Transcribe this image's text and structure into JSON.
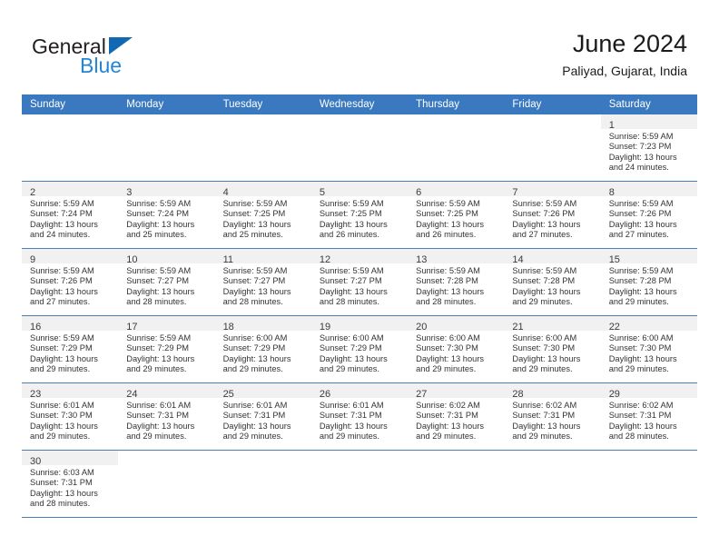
{
  "brand": {
    "name_top": "General",
    "name_bottom": "Blue",
    "triangle_icon": "triangle-icon",
    "color_dark": "#231f20",
    "color_blue": "#2585d3"
  },
  "header": {
    "title": "June 2024",
    "subtitle": "Paliyad, Gujarat, India"
  },
  "theme": {
    "header_row_bg": "#3a79bf",
    "header_row_text": "#ffffff",
    "daynum_band_bg": "#f1f1f1",
    "row_divider": "#4a7fbd"
  },
  "weekdays": [
    "Sunday",
    "Monday",
    "Tuesday",
    "Wednesday",
    "Thursday",
    "Friday",
    "Saturday"
  ],
  "calendar": {
    "month": "June",
    "year": "2024",
    "weeks": [
      [
        {
          "empty": true
        },
        {
          "empty": true
        },
        {
          "empty": true
        },
        {
          "empty": true
        },
        {
          "empty": true
        },
        {
          "empty": true
        },
        {
          "day": "1",
          "sunrise": "Sunrise: 5:59 AM",
          "sunset": "Sunset: 7:23 PM",
          "daylight1": "Daylight: 13 hours",
          "daylight2": "and 24 minutes."
        }
      ],
      [
        {
          "day": "2",
          "sunrise": "Sunrise: 5:59 AM",
          "sunset": "Sunset: 7:24 PM",
          "daylight1": "Daylight: 13 hours",
          "daylight2": "and 24 minutes."
        },
        {
          "day": "3",
          "sunrise": "Sunrise: 5:59 AM",
          "sunset": "Sunset: 7:24 PM",
          "daylight1": "Daylight: 13 hours",
          "daylight2": "and 25 minutes."
        },
        {
          "day": "4",
          "sunrise": "Sunrise: 5:59 AM",
          "sunset": "Sunset: 7:25 PM",
          "daylight1": "Daylight: 13 hours",
          "daylight2": "and 25 minutes."
        },
        {
          "day": "5",
          "sunrise": "Sunrise: 5:59 AM",
          "sunset": "Sunset: 7:25 PM",
          "daylight1": "Daylight: 13 hours",
          "daylight2": "and 26 minutes."
        },
        {
          "day": "6",
          "sunrise": "Sunrise: 5:59 AM",
          "sunset": "Sunset: 7:25 PM",
          "daylight1": "Daylight: 13 hours",
          "daylight2": "and 26 minutes."
        },
        {
          "day": "7",
          "sunrise": "Sunrise: 5:59 AM",
          "sunset": "Sunset: 7:26 PM",
          "daylight1": "Daylight: 13 hours",
          "daylight2": "and 27 minutes."
        },
        {
          "day": "8",
          "sunrise": "Sunrise: 5:59 AM",
          "sunset": "Sunset: 7:26 PM",
          "daylight1": "Daylight: 13 hours",
          "daylight2": "and 27 minutes."
        }
      ],
      [
        {
          "day": "9",
          "sunrise": "Sunrise: 5:59 AM",
          "sunset": "Sunset: 7:26 PM",
          "daylight1": "Daylight: 13 hours",
          "daylight2": "and 27 minutes."
        },
        {
          "day": "10",
          "sunrise": "Sunrise: 5:59 AM",
          "sunset": "Sunset: 7:27 PM",
          "daylight1": "Daylight: 13 hours",
          "daylight2": "and 28 minutes."
        },
        {
          "day": "11",
          "sunrise": "Sunrise: 5:59 AM",
          "sunset": "Sunset: 7:27 PM",
          "daylight1": "Daylight: 13 hours",
          "daylight2": "and 28 minutes."
        },
        {
          "day": "12",
          "sunrise": "Sunrise: 5:59 AM",
          "sunset": "Sunset: 7:27 PM",
          "daylight1": "Daylight: 13 hours",
          "daylight2": "and 28 minutes."
        },
        {
          "day": "13",
          "sunrise": "Sunrise: 5:59 AM",
          "sunset": "Sunset: 7:28 PM",
          "daylight1": "Daylight: 13 hours",
          "daylight2": "and 28 minutes."
        },
        {
          "day": "14",
          "sunrise": "Sunrise: 5:59 AM",
          "sunset": "Sunset: 7:28 PM",
          "daylight1": "Daylight: 13 hours",
          "daylight2": "and 29 minutes."
        },
        {
          "day": "15",
          "sunrise": "Sunrise: 5:59 AM",
          "sunset": "Sunset: 7:28 PM",
          "daylight1": "Daylight: 13 hours",
          "daylight2": "and 29 minutes."
        }
      ],
      [
        {
          "day": "16",
          "sunrise": "Sunrise: 5:59 AM",
          "sunset": "Sunset: 7:29 PM",
          "daylight1": "Daylight: 13 hours",
          "daylight2": "and 29 minutes."
        },
        {
          "day": "17",
          "sunrise": "Sunrise: 5:59 AM",
          "sunset": "Sunset: 7:29 PM",
          "daylight1": "Daylight: 13 hours",
          "daylight2": "and 29 minutes."
        },
        {
          "day": "18",
          "sunrise": "Sunrise: 6:00 AM",
          "sunset": "Sunset: 7:29 PM",
          "daylight1": "Daylight: 13 hours",
          "daylight2": "and 29 minutes."
        },
        {
          "day": "19",
          "sunrise": "Sunrise: 6:00 AM",
          "sunset": "Sunset: 7:29 PM",
          "daylight1": "Daylight: 13 hours",
          "daylight2": "and 29 minutes."
        },
        {
          "day": "20",
          "sunrise": "Sunrise: 6:00 AM",
          "sunset": "Sunset: 7:30 PM",
          "daylight1": "Daylight: 13 hours",
          "daylight2": "and 29 minutes."
        },
        {
          "day": "21",
          "sunrise": "Sunrise: 6:00 AM",
          "sunset": "Sunset: 7:30 PM",
          "daylight1": "Daylight: 13 hours",
          "daylight2": "and 29 minutes."
        },
        {
          "day": "22",
          "sunrise": "Sunrise: 6:00 AM",
          "sunset": "Sunset: 7:30 PM",
          "daylight1": "Daylight: 13 hours",
          "daylight2": "and 29 minutes."
        }
      ],
      [
        {
          "day": "23",
          "sunrise": "Sunrise: 6:01 AM",
          "sunset": "Sunset: 7:30 PM",
          "daylight1": "Daylight: 13 hours",
          "daylight2": "and 29 minutes."
        },
        {
          "day": "24",
          "sunrise": "Sunrise: 6:01 AM",
          "sunset": "Sunset: 7:31 PM",
          "daylight1": "Daylight: 13 hours",
          "daylight2": "and 29 minutes."
        },
        {
          "day": "25",
          "sunrise": "Sunrise: 6:01 AM",
          "sunset": "Sunset: 7:31 PM",
          "daylight1": "Daylight: 13 hours",
          "daylight2": "and 29 minutes."
        },
        {
          "day": "26",
          "sunrise": "Sunrise: 6:01 AM",
          "sunset": "Sunset: 7:31 PM",
          "daylight1": "Daylight: 13 hours",
          "daylight2": "and 29 minutes."
        },
        {
          "day": "27",
          "sunrise": "Sunrise: 6:02 AM",
          "sunset": "Sunset: 7:31 PM",
          "daylight1": "Daylight: 13 hours",
          "daylight2": "and 29 minutes."
        },
        {
          "day": "28",
          "sunrise": "Sunrise: 6:02 AM",
          "sunset": "Sunset: 7:31 PM",
          "daylight1": "Daylight: 13 hours",
          "daylight2": "and 29 minutes."
        },
        {
          "day": "29",
          "sunrise": "Sunrise: 6:02 AM",
          "sunset": "Sunset: 7:31 PM",
          "daylight1": "Daylight: 13 hours",
          "daylight2": "and 28 minutes."
        }
      ],
      [
        {
          "day": "30",
          "sunrise": "Sunrise: 6:03 AM",
          "sunset": "Sunset: 7:31 PM",
          "daylight1": "Daylight: 13 hours",
          "daylight2": "and 28 minutes."
        },
        {
          "empty": true
        },
        {
          "empty": true
        },
        {
          "empty": true
        },
        {
          "empty": true
        },
        {
          "empty": true
        },
        {
          "empty": true
        }
      ]
    ]
  }
}
